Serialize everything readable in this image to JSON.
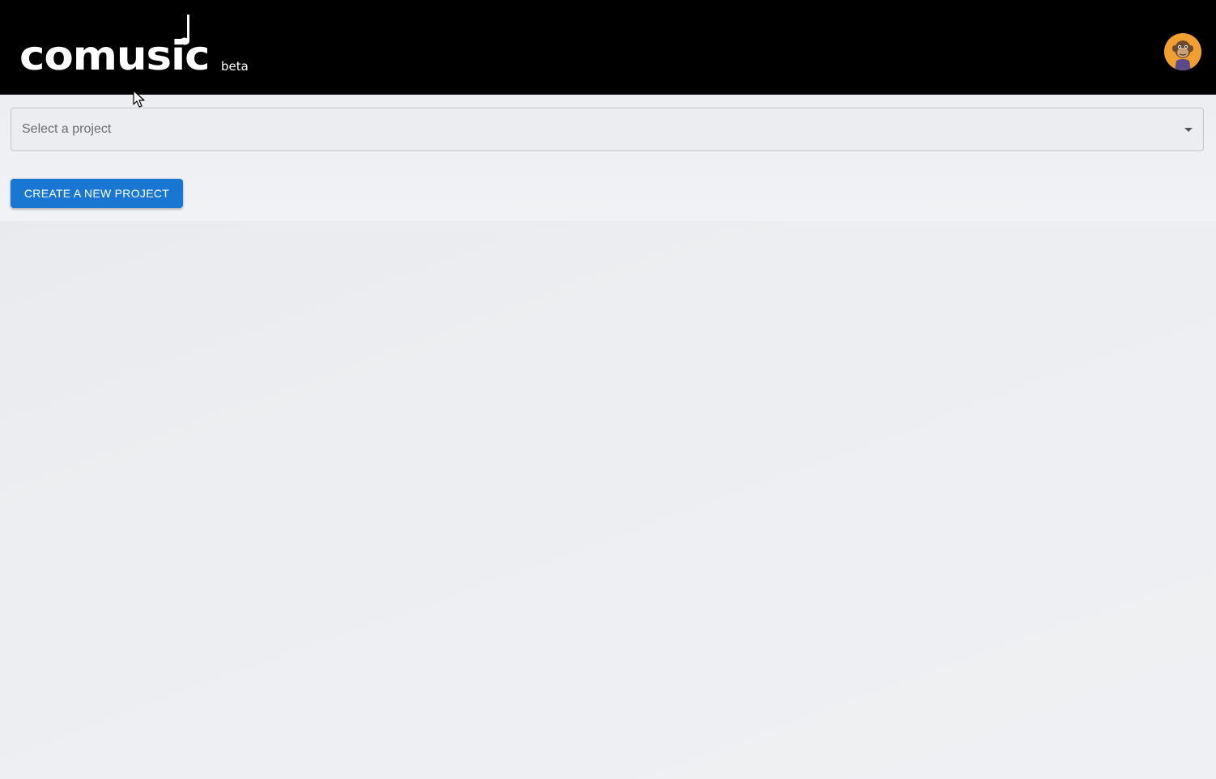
{
  "header": {
    "logo_text": "comusic",
    "logo_badge": "beta",
    "avatar_icon": "ape-avatar-icon",
    "background": "#000000"
  },
  "project_select": {
    "placeholder": "Select a project",
    "arrow_icon": "caret-down-icon"
  },
  "actions": {
    "create_project_label": "CREATE A NEW PROJECT",
    "accent": "#1976d2"
  }
}
